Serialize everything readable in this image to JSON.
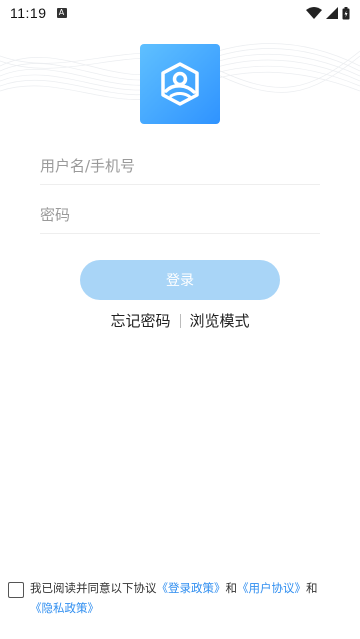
{
  "status_bar": {
    "time": "11:19",
    "notification_icon": "a-icon",
    "icons": [
      "wifi-icon",
      "signal-icon",
      "battery-icon"
    ]
  },
  "logo": {
    "icon": "shield-person-icon",
    "colors": [
      "#5fc0ff",
      "#2f93ff"
    ]
  },
  "form": {
    "username_placeholder": "用户名/手机号",
    "username_value": "",
    "password_placeholder": "密码",
    "password_value": ""
  },
  "actions": {
    "login_label": "登录",
    "forgot_password_label": "忘记密码",
    "browse_mode_label": "浏览模式"
  },
  "agreement": {
    "checked": false,
    "prefix": "我已阅读并同意以下协议",
    "login_policy": "《登录政策》",
    "connector": "和",
    "user_agreement": "《用户协议》",
    "connector2": "和",
    "privacy_policy": "《隐私政策》"
  },
  "colors": {
    "accent": "#2f8ef0",
    "login_button_bg": "#a9d5f7"
  }
}
